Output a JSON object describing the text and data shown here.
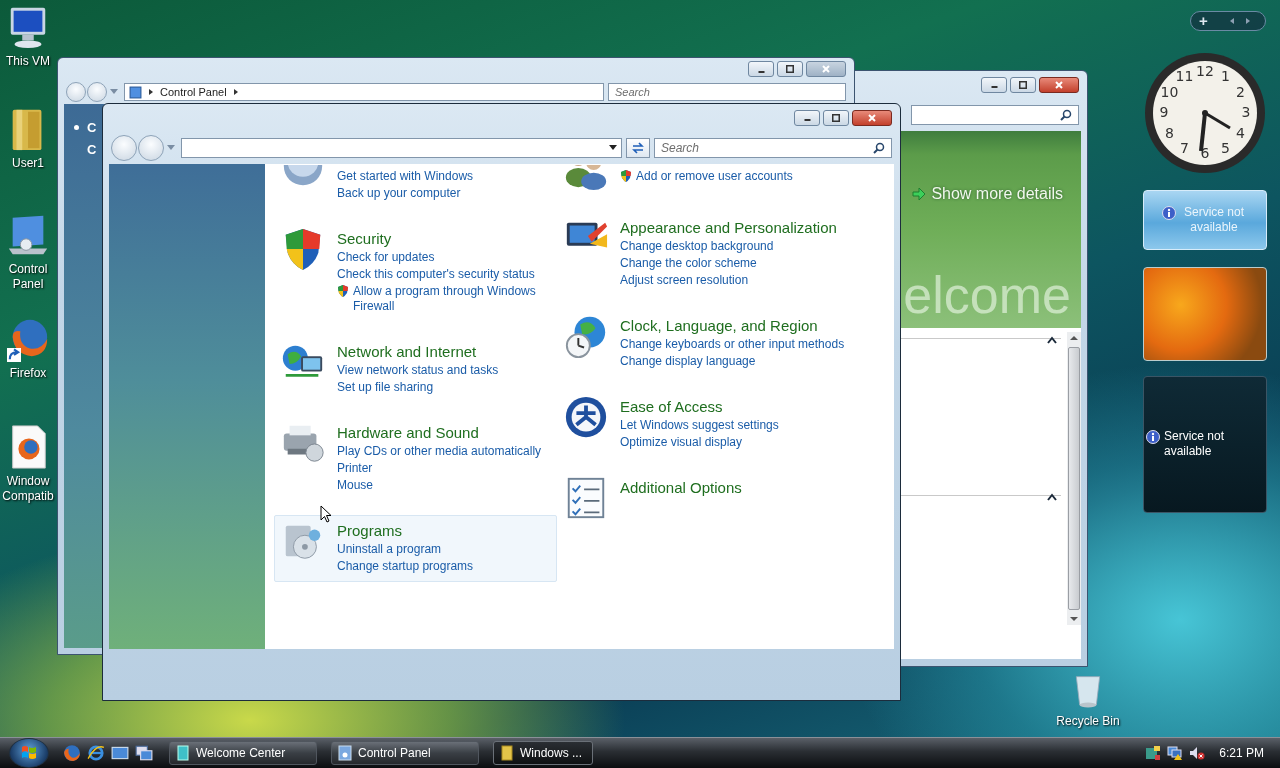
{
  "desktop_icons": [
    {
      "kind": "computer",
      "label": "This VM",
      "shortcut": false
    },
    {
      "kind": "folder",
      "label": "User1",
      "shortcut": false
    },
    {
      "kind": "control-panel",
      "label": "Control Panel",
      "shortcut": false
    },
    {
      "kind": "firefox",
      "label": "Firefox",
      "shortcut": true
    },
    {
      "kind": "document",
      "label": "Window Compatib",
      "shortcut": false
    }
  ],
  "welcome_window": {
    "banner": {
      "link": "Show more details",
      "watermark": "elcome"
    },
    "sections": [
      {
        "expanded": true
      },
      {
        "expanded": true
      }
    ]
  },
  "back_window": {
    "breadcrumb": [
      "Control Panel"
    ],
    "search_placeholder": "Search",
    "left_links": [
      {
        "text": "C",
        "current": true
      },
      {
        "text": "C",
        "current": false
      }
    ]
  },
  "front_window": {
    "search_placeholder": "Search",
    "columns": [
      [
        {
          "kind": "backup",
          "highlighted": false,
          "links": [
            {
              "text": "Get started with Windows",
              "shield": false
            },
            {
              "text": "Back up your computer",
              "shield": false
            }
          ]
        },
        {
          "kind": "security",
          "title": "Security",
          "highlighted": false,
          "links": [
            {
              "text": "Check for updates",
              "shield": false
            },
            {
              "text": "Check this computer's security status",
              "shield": false
            },
            {
              "text": "Allow a program through Windows Firewall",
              "shield": true
            }
          ]
        },
        {
          "kind": "network",
          "title": "Network and Internet",
          "highlighted": false,
          "links": [
            {
              "text": "View network status and tasks",
              "shield": false
            },
            {
              "text": "Set up file sharing",
              "shield": false
            }
          ]
        },
        {
          "kind": "hardware",
          "title": "Hardware and Sound",
          "highlighted": false,
          "links": [
            {
              "text": "Play CDs or other media automatically",
              "shield": false
            },
            {
              "text": "Printer",
              "shield": false
            },
            {
              "text": "Mouse",
              "shield": false
            }
          ]
        },
        {
          "kind": "programs",
          "title": "Programs",
          "highlighted": true,
          "links": [
            {
              "text": "Uninstall a program",
              "shield": false
            },
            {
              "text": "Change startup programs",
              "shield": false
            }
          ]
        }
      ],
      [
        {
          "kind": "users",
          "highlighted": false,
          "links": [
            {
              "text": "Add or remove user accounts",
              "shield": true
            }
          ]
        },
        {
          "kind": "appearance",
          "title": "Appearance and Personalization",
          "highlighted": false,
          "links": [
            {
              "text": "Change desktop background",
              "shield": false
            },
            {
              "text": "Change the color scheme",
              "shield": false
            },
            {
              "text": "Adjust screen resolution",
              "shield": false
            }
          ]
        },
        {
          "kind": "clock",
          "title": "Clock, Language, and Region",
          "highlighted": false,
          "links": [
            {
              "text": "Change keyboards or other input methods",
              "shield": false
            },
            {
              "text": "Change display language",
              "shield": false
            }
          ]
        },
        {
          "kind": "ease",
          "title": "Ease of Access",
          "highlighted": false,
          "links": [
            {
              "text": "Let Windows suggest settings",
              "shield": false
            },
            {
              "text": "Optimize visual display",
              "shield": false
            }
          ]
        },
        {
          "kind": "options",
          "title": "Additional Options",
          "highlighted": false
        }
      ]
    ]
  },
  "sidebar": {
    "add_button": "+",
    "clock_numerals": [
      "12",
      "11",
      "1",
      "10",
      "2",
      "9",
      "3",
      "8",
      "4",
      "7",
      "5",
      "6"
    ],
    "gadgets": [
      {
        "kind": "status-light",
        "message": "Service not available"
      },
      {
        "kind": "photo"
      },
      {
        "kind": "status-dark",
        "message": "Service not available"
      }
    ]
  },
  "recycle_bin": {
    "label": "Recycle Bin"
  },
  "taskbar": {
    "buttons": [
      {
        "kind": "welcome",
        "label": "Welcome Center",
        "selected": false
      },
      {
        "kind": "control-panel",
        "label": "Control Panel",
        "selected": false
      },
      {
        "kind": "folder",
        "label": "Windows ...",
        "selected": true
      }
    ],
    "clock": "6:21 PM"
  }
}
